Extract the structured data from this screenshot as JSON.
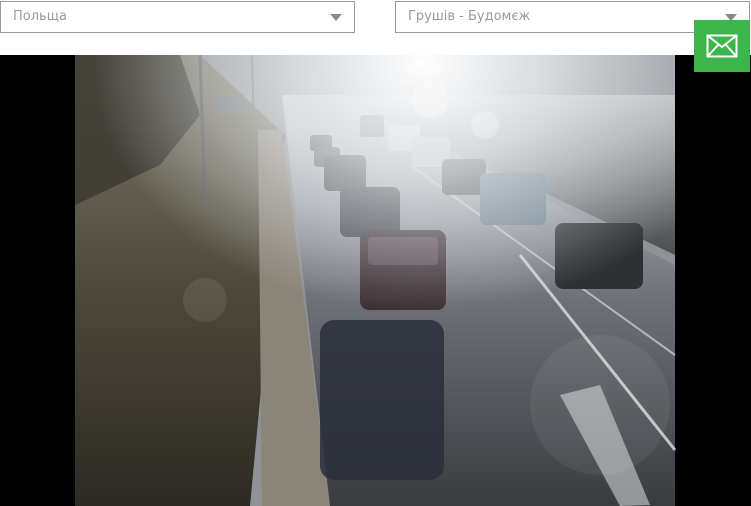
{
  "filters": {
    "country_value": "Польща",
    "crossing_value": "Грушів - Будомєж"
  },
  "icons": {
    "dropdown": "chevron-down-icon",
    "contact": "envelope-icon"
  },
  "colors": {
    "contact_button": "#3cb64a",
    "select_border": "#9a9a9a",
    "select_text": "#9a9a9a"
  }
}
